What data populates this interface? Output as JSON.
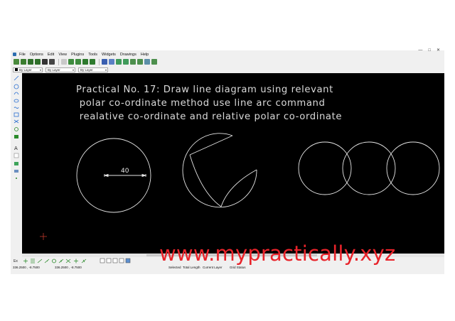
{
  "window": {
    "controls": [
      "—",
      "□",
      "✕"
    ]
  },
  "menubar": {
    "items": [
      "File",
      "Options",
      "Edit",
      "View",
      "Plugins",
      "Tools",
      "Widgets",
      "Drawings",
      "Help"
    ]
  },
  "toolbar": {
    "icons": [
      "new-file-icon",
      "open-file-icon",
      "save-icon",
      "save-as-icon",
      "print-icon",
      "print-preview-icon",
      "cut-icon",
      "copy-icon",
      "paste-icon",
      "undo-icon",
      "redo-icon",
      "grid-icon",
      "draft-icon",
      "zoom-in-icon",
      "zoom-out-icon",
      "zoom-auto-icon",
      "zoom-previous-icon",
      "zoom-window-icon",
      "zoom-pan-icon",
      "redraw-icon"
    ]
  },
  "layerbar": {
    "layer": "By Layer",
    "line_type": "By Layer",
    "line_width": "By Layer"
  },
  "canvas": {
    "lines": [
      "Practical No. 17: Draw line diagram using relevant",
      " polar co-ordinate method use line arc command",
      " realative co-ordinate and relative polar co-ordinate"
    ],
    "dimension": "40",
    "background": "#000000",
    "stroke": "#e6e6e6"
  },
  "snapbar": {
    "label": "Ex"
  },
  "statusbar": {
    "abs_coord": "336.2500 , -8.7500",
    "rel_coord": "336.2500 , -8.7500",
    "selected_label": "Selected",
    "total_length_label": "Total Length",
    "current_layer_label": "Current Layer",
    "grid_status_label": "Grid Status"
  },
  "watermark": {
    "text": "www.mypractically.xyz",
    "color": "#e8232a"
  }
}
